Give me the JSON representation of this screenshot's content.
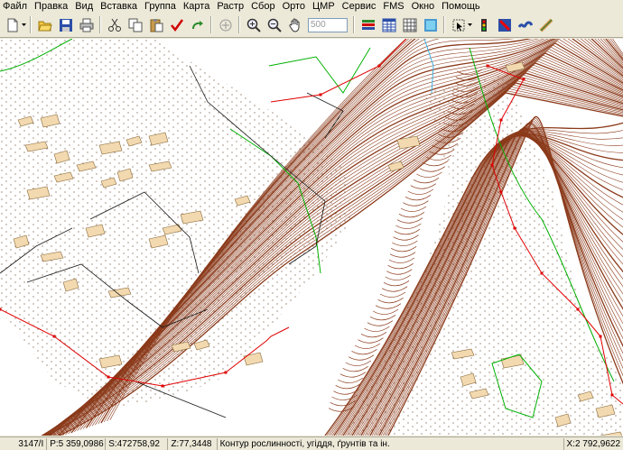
{
  "menu": {
    "items": [
      "Файл",
      "Правка",
      "Вид",
      "Вставка",
      "Группа",
      "Карта",
      "Растр",
      "Сбор",
      "Орто",
      "ЦМР",
      "Сервис",
      "FMS",
      "Окно",
      "Помощь"
    ]
  },
  "toolbar": {
    "zoom_value": "500",
    "icons": [
      "new-doc-icon",
      "open-folder-icon",
      "save-icon",
      "print-icon",
      "cut-icon",
      "copy-icon",
      "paste-icon",
      "check-icon",
      "redo-icon",
      "add-icon",
      "zoom-in-icon",
      "zoom-out-icon",
      "pan-hand-icon",
      "layers-icon",
      "table-icon",
      "grid-icon",
      "color-icon",
      "cursor-icon",
      "traffic-icon",
      "no-entry-icon",
      "waveform-icon",
      "ruler-icon"
    ]
  },
  "status": {
    "count": "3147/I",
    "perimeter": "P:5 359,0986",
    "area": "S:472758,92",
    "z_value": "Z:77,3448",
    "layer_desc": "Контур рослинності, угіддя, ґрунтів та ін.",
    "x_coord": "X:2 792,9622"
  },
  "colors": {
    "contour": "#8b3a1a",
    "boundary_red": "#e00000",
    "vegetation_green": "#00b000",
    "building_fill": "#f2d9b0",
    "road_line": "#1a1a1a"
  }
}
